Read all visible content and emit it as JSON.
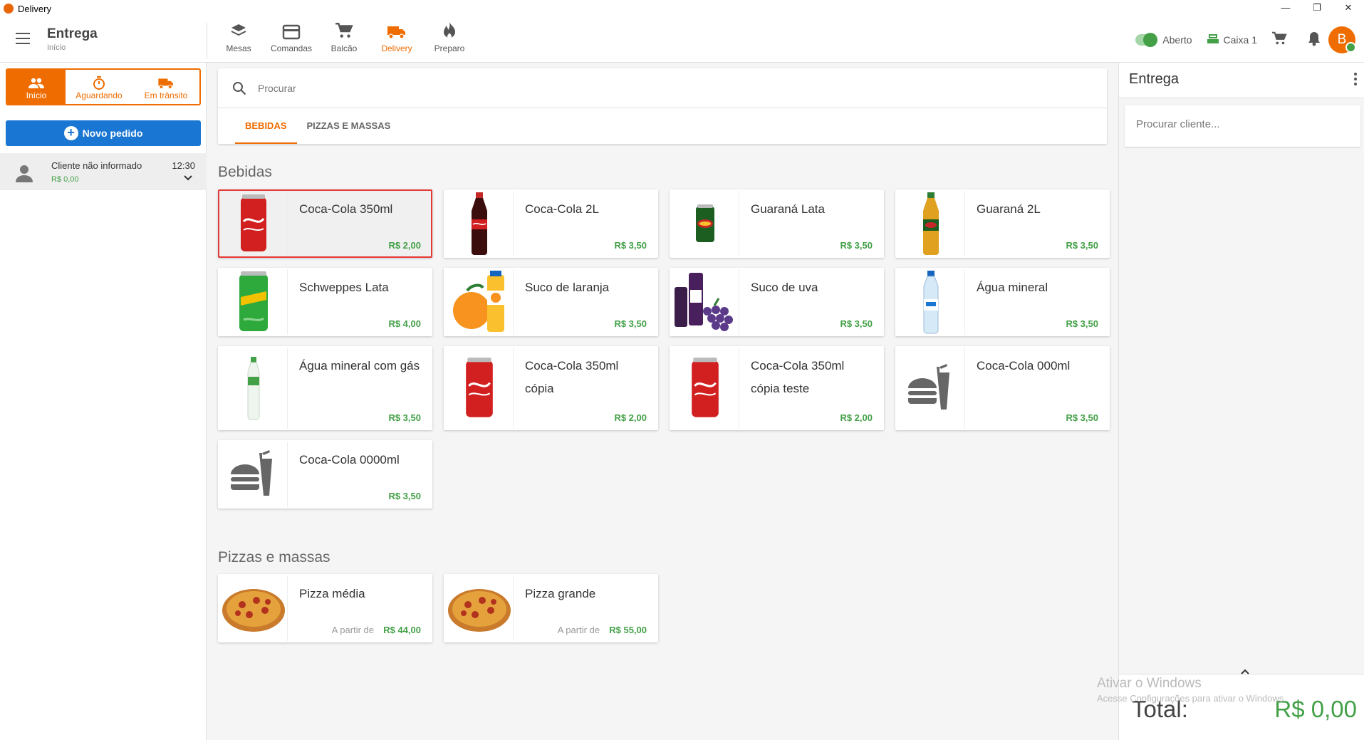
{
  "window": {
    "title": "Delivery",
    "controls": [
      "—",
      "❐",
      "✕"
    ]
  },
  "header": {
    "title": "Entrega",
    "subtitle": "Início",
    "nav": [
      {
        "label": "Mesas",
        "icon": "layers-icon"
      },
      {
        "label": "Comandas",
        "icon": "card-icon"
      },
      {
        "label": "Balcão",
        "icon": "cart-icon"
      },
      {
        "label": "Delivery",
        "icon": "truck-icon",
        "active": true
      },
      {
        "label": "Preparo",
        "icon": "fire-icon"
      }
    ],
    "status_label": "Aberto",
    "cashier_label": "Caixa 1",
    "avatar_initial": "B"
  },
  "left": {
    "segments": [
      {
        "label": "Início",
        "icon": "people-icon",
        "active": true
      },
      {
        "label": "Aguardando",
        "icon": "timer-icon"
      },
      {
        "label": "Em trânsito",
        "icon": "truck-icon"
      }
    ],
    "new_order_label": "Novo pedido",
    "orders": [
      {
        "client": "Cliente não informado",
        "time": "12:30",
        "value": "R$ 0,00"
      }
    ]
  },
  "search": {
    "placeholder": "Procurar"
  },
  "category_tabs": [
    {
      "label": "BEBIDAS",
      "active": true
    },
    {
      "label": "PIZZAS E MASSAS"
    }
  ],
  "sections": [
    {
      "title": "Bebidas",
      "products": [
        {
          "name": "Coca-Cola 350ml",
          "price": "R$ 2,00",
          "image": "coke-can",
          "selected": true
        },
        {
          "name": "Coca-Cola 2L",
          "price": "R$ 3,50",
          "image": "coke-bottle"
        },
        {
          "name": "Guaraná Lata",
          "price": "R$ 3,50",
          "image": "guarana-can"
        },
        {
          "name": "Guaraná 2L",
          "price": "R$ 3,50",
          "image": "guarana-bottle"
        },
        {
          "name": "Schweppes Lata",
          "price": "R$ 4,00",
          "image": "schweppes-can"
        },
        {
          "name": "Suco de laranja",
          "price": "R$ 3,50",
          "image": "orange-juice"
        },
        {
          "name": "Suco de uva",
          "price": "R$ 3,50",
          "image": "grape-juice"
        },
        {
          "name": "Água mineral",
          "price": "R$ 3,50",
          "image": "water-bottle"
        },
        {
          "name": "Água mineral com gás",
          "price": "R$ 3,50",
          "image": "sparkling-water"
        },
        {
          "name": "Coca-Cola 350ml cópia",
          "price": "R$ 2,00",
          "image": "coke-can"
        },
        {
          "name": "Coca-Cola 350ml cópia teste",
          "price": "R$ 2,00",
          "image": "coke-can"
        },
        {
          "name": "Coca-Cola 000ml",
          "price": "R$ 3,50",
          "image": "placeholder-food"
        },
        {
          "name": "Coca-Cola 0000ml",
          "price": "R$ 3,50",
          "image": "placeholder-food"
        }
      ]
    },
    {
      "title": "Pizzas e massas",
      "products": [
        {
          "name": "Pizza média",
          "prefix": "A partir de",
          "price": "R$ 44,00",
          "image": "pizza"
        },
        {
          "name": "Pizza grande",
          "prefix": "A partir de",
          "price": "R$ 55,00",
          "image": "pizza"
        }
      ]
    }
  ],
  "right": {
    "title": "Entrega",
    "client_search_placeholder": "Procurar cliente...",
    "total_label": "Total:",
    "total_value": "R$ 0,00"
  },
  "watermark": {
    "line1": "Ativar o Windows",
    "line2": "Acesse Configurações para ativar o Windows."
  },
  "colors": {
    "accent": "#ef6c00",
    "primary": "#1976d2",
    "price": "#43a047",
    "selected_border": "#e53935"
  }
}
